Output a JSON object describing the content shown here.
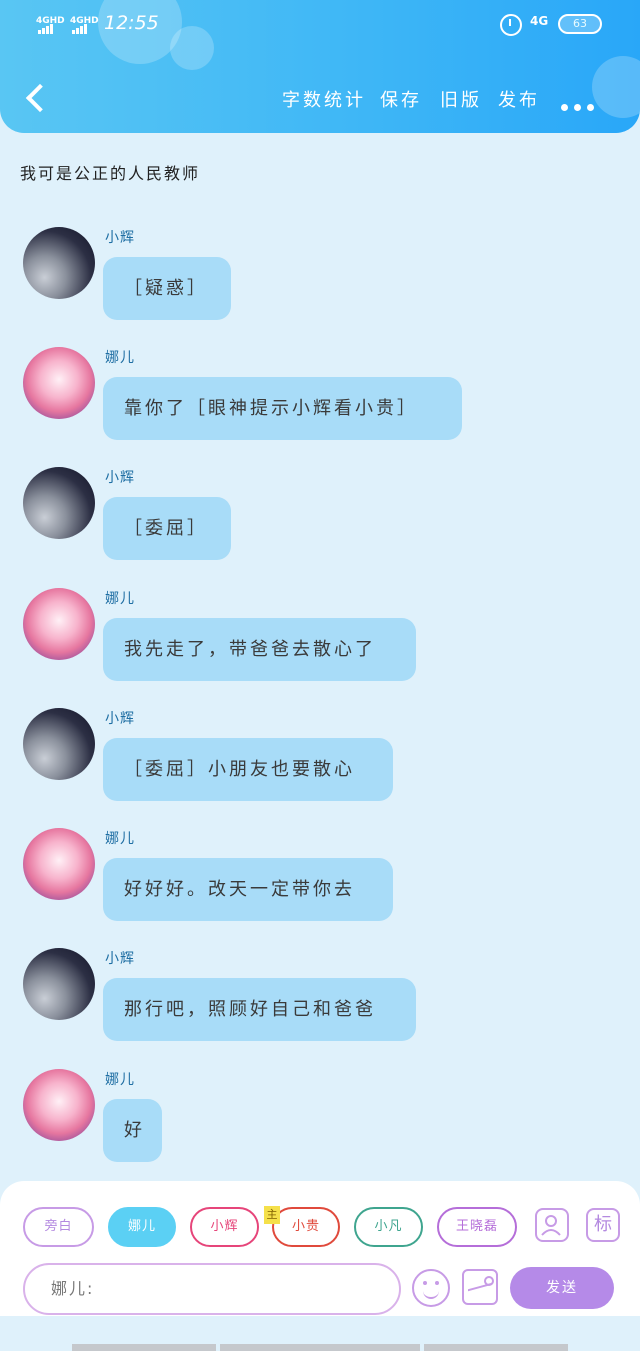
{
  "status_bar": {
    "signal1": "4GHD",
    "signal2": "4GHD",
    "time": "12:55",
    "network": "4G",
    "battery": "63"
  },
  "header": {
    "menu": [
      "字数统计",
      "保存",
      "旧版",
      "发布"
    ]
  },
  "subtitle": "我可是公正的人民教师",
  "messages": [
    {
      "name": "小辉",
      "text": "［疑惑］"
    },
    {
      "name": "娜儿",
      "text": "靠你了［眼神提示小辉看小贵］"
    },
    {
      "name": "小辉",
      "text": "［委屈］"
    },
    {
      "name": "娜儿",
      "text": "我先走了，带爸爸去散心了"
    },
    {
      "name": "小辉",
      "text": "［委屈］小朋友也要散心"
    },
    {
      "name": "娜儿",
      "text": "好好好。改天一定带你去"
    },
    {
      "name": "小辉",
      "text": "那行吧，照顾好自己和爸爸"
    },
    {
      "name": "娜儿",
      "text": "好"
    }
  ],
  "roles": [
    {
      "label": "旁白",
      "color": "#c79be6"
    },
    {
      "label": "娜儿",
      "color": "#5bd0f4",
      "active": true
    },
    {
      "label": "小辉",
      "color": "#e6457a"
    },
    {
      "label": "小贵",
      "color": "#e04a3c"
    },
    {
      "label": "小凡",
      "color": "#3fa58f"
    },
    {
      "label": "王晓磊",
      "color": "#b56ed9"
    }
  ],
  "main_tag": "主",
  "tools": {
    "add_role_icon": "person-icon",
    "mark_label": "标"
  },
  "input": {
    "value": "娜儿:"
  },
  "send_label": "发送"
}
